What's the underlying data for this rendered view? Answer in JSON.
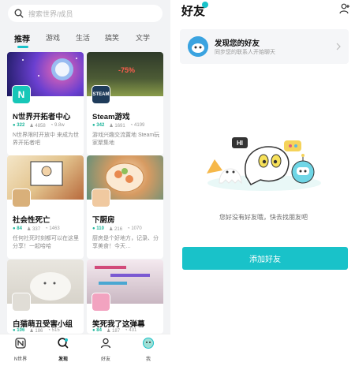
{
  "search": {
    "placeholder": "搜索世界/成员"
  },
  "tabs": [
    {
      "label": "推荐",
      "active": true
    },
    {
      "label": "游戏"
    },
    {
      "label": "生活"
    },
    {
      "label": "搞笑"
    },
    {
      "label": "文学"
    }
  ],
  "cards": [
    {
      "title": "N世界开拓者中心",
      "stats": {
        "a": "322",
        "b": "4858",
        "c": "9.8w"
      },
      "desc": "N世界限时开放中 来成为世界开拓者吧",
      "badge_text": "N",
      "badge_color": "#17c7b8"
    },
    {
      "title": "Steam游戏",
      "stats": {
        "a": "342",
        "b": "1691",
        "c": "4199"
      },
      "desc": "游戏兴趣交流置地 Steam玩家聚集地",
      "badge_text": "STEAM",
      "badge_color": "#1e3b5a",
      "thumb_text": "-75%"
    },
    {
      "title": "社会性死亡",
      "stats": {
        "a": "84",
        "b": "337",
        "c": "1463"
      },
      "desc": "任何社死时刻都可以在这里分享！一起哈哈",
      "badge_color": "#d9b07a"
    },
    {
      "title": "下厨房",
      "stats": {
        "a": "110",
        "b": "216",
        "c": "1070"
      },
      "desc": "厨房是个好地方，记录、分享美食！今天…",
      "badge_color": "#f0c9a0"
    },
    {
      "title": "白猫萌丑受害小组",
      "stats": {
        "a": "106",
        "b": "186",
        "c": "515"
      },
      "badge_color": "#e0ddd6"
    },
    {
      "title": "笑死我了这弹幕",
      "stats": {
        "a": "84",
        "b": "187",
        "c": "431"
      },
      "badge_color": "#f2a3c0"
    }
  ],
  "bottom_nav": [
    {
      "label": "N世界",
      "icon": "n-world-icon"
    },
    {
      "label": "发现",
      "icon": "discover-icon",
      "active": true
    },
    {
      "label": "好友",
      "icon": "friends-icon"
    },
    {
      "label": "我",
      "icon": "me-avatar-icon"
    }
  ],
  "right": {
    "title": "好友",
    "discover_title": "发现您的好友",
    "discover_sub": "同步您的联系人开始聊天",
    "illus_text": "HI",
    "empty_text": "您好没有好友哦，快去找朋友吧",
    "add_button": "添加好友",
    "accent": "#19c2c9"
  }
}
